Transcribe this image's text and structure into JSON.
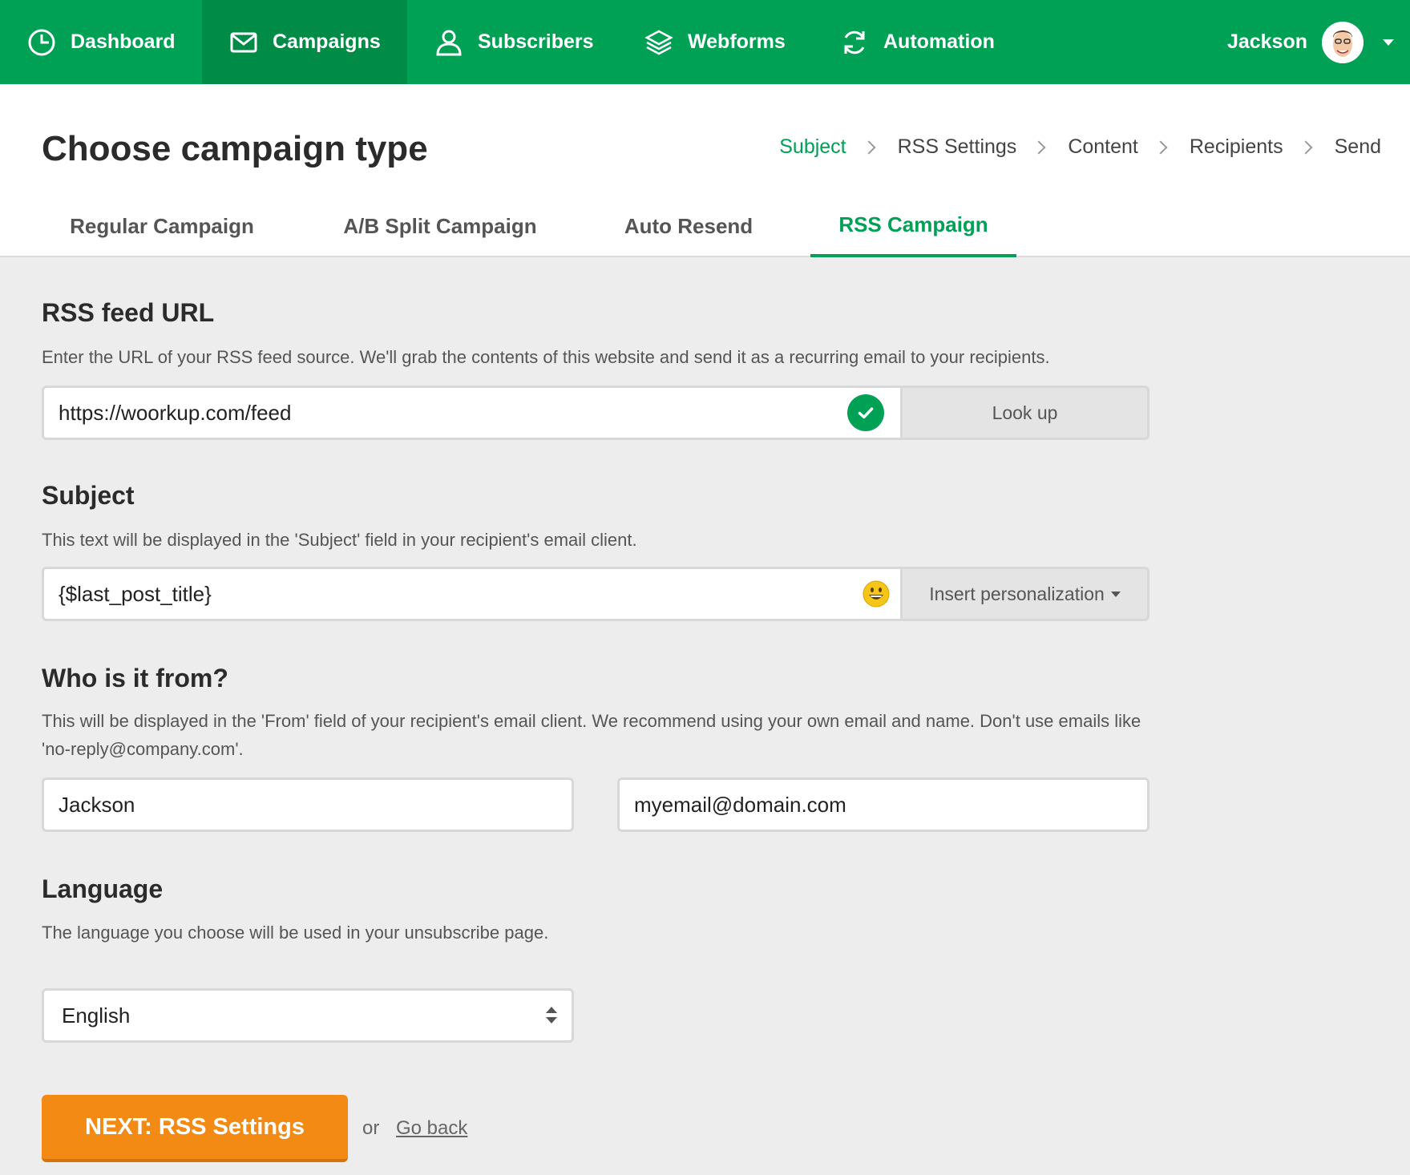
{
  "nav": {
    "items": [
      {
        "label": "Dashboard",
        "icon": "dashboard-clock-icon"
      },
      {
        "label": "Campaigns",
        "icon": "envelope-icon"
      },
      {
        "label": "Subscribers",
        "icon": "user-icon"
      },
      {
        "label": "Webforms",
        "icon": "layers-icon"
      },
      {
        "label": "Automation",
        "icon": "refresh-icon"
      }
    ],
    "active": "Campaigns",
    "user_name": "Jackson",
    "colors": {
      "bar": "#00a055",
      "active": "#008c47"
    }
  },
  "header": {
    "title": "Choose campaign type",
    "breadcrumb": [
      "Subject",
      "RSS Settings",
      "Content",
      "Recipients",
      "Send"
    ],
    "breadcrumb_current": "Subject",
    "tabs": [
      "Regular Campaign",
      "A/B Split Campaign",
      "Auto Resend",
      "RSS Campaign"
    ],
    "active_tab": "RSS Campaign"
  },
  "rss": {
    "title": "RSS feed URL",
    "help": "Enter the URL of your RSS feed source. We'll grab the contents of this website and send it as a recurring email to your recipients.",
    "url_value": "https://woorkup.com/feed",
    "status_icon": "check-circle-icon",
    "lookup_label": "Look up"
  },
  "subject": {
    "title": "Subject",
    "help": "This text will be displayed in the 'Subject' field in your recipient's email client.",
    "value": "{$last_post_title}",
    "emoji_icon": "smiley-emoji-icon",
    "personalization_label": "Insert personalization"
  },
  "from": {
    "title": "Who is it from?",
    "help": "This will be displayed in the 'From' field of your recipient's email client. We recommend using your own email and name. Don't use emails like 'no-reply@company.com'.",
    "name_value": "Jackson",
    "email_value": "myemail@domain.com"
  },
  "language": {
    "title": "Language",
    "help": "The language you choose will be used in your unsubscribe page.",
    "selected": "English"
  },
  "footer": {
    "next_label": "NEXT: RSS Settings",
    "or_label": "or",
    "back_label": "Go back",
    "next_color": "#f28a13"
  }
}
